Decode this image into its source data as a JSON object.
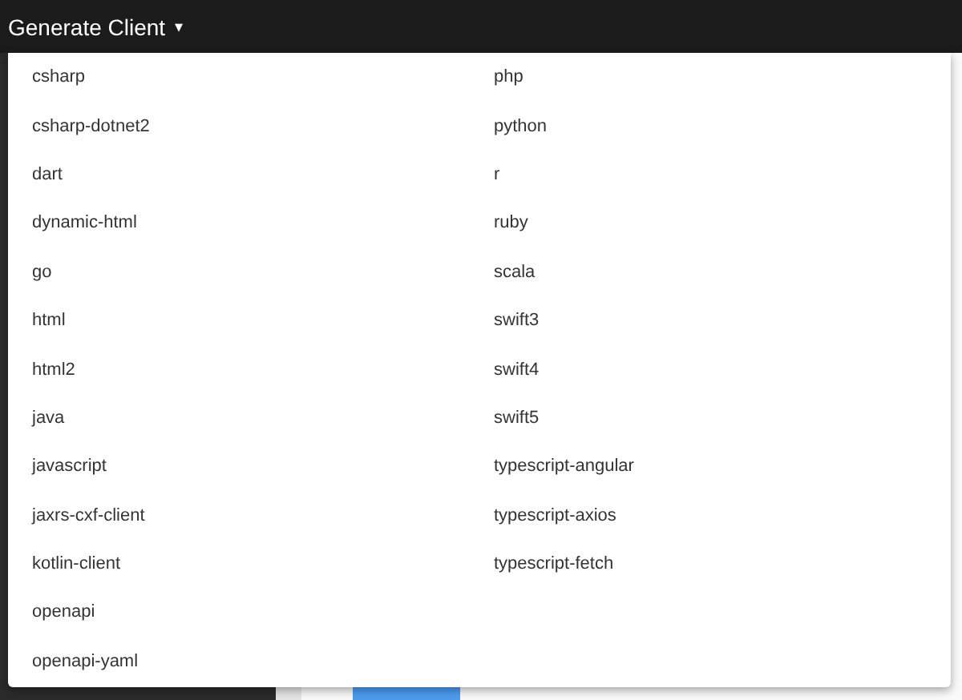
{
  "top_bar": {
    "menu_button": {
      "label": "Generate Client",
      "caret": "▾",
      "expanded": true
    }
  },
  "dropdown": {
    "items": [
      "csharp",
      "csharp-dotnet2",
      "dart",
      "dynamic-html",
      "go",
      "html",
      "html2",
      "java",
      "javascript",
      "jaxrs-cxf-client",
      "kotlin-client",
      "openapi",
      "openapi-yaml",
      "php",
      "python",
      "r",
      "ruby",
      "scala",
      "swift3",
      "swift4",
      "swift5",
      "typescript-angular",
      "typescript-axios",
      "typescript-fetch"
    ]
  }
}
